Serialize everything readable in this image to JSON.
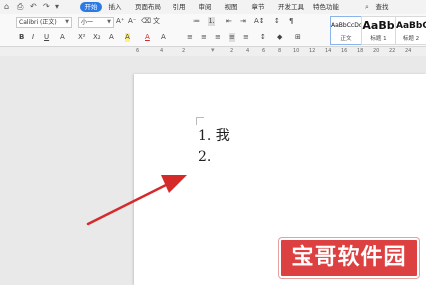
{
  "quick_access": [
    "⌂",
    "⎙",
    "↶",
    "↷",
    "▾"
  ],
  "menu": {
    "items": [
      "开始",
      "插入",
      "页面布局",
      "引用",
      "审阅",
      "视图",
      "章节",
      "开发工具",
      "特色功能"
    ],
    "active_index": 0,
    "search_label": "查找"
  },
  "font": {
    "name": "Calibri (正文)",
    "size": "小一"
  },
  "format_buttons": {
    "bold": "B",
    "italic": "I",
    "underline": "U",
    "strike": "A",
    "superscript": "X²",
    "subscript": "X₂",
    "highlight": "A",
    "font_color": "A",
    "clear": "A"
  },
  "paragraph_buttons": [
    "≔",
    "⒈",
    "⇤",
    "⇥",
    "A↕",
    "↕"
  ],
  "styles": [
    {
      "sample": "AaBbCcDd",
      "name": "正文"
    },
    {
      "sample": "AaBb",
      "name": "标题 1"
    },
    {
      "sample": "AaBbC",
      "name": "标题 2"
    }
  ],
  "ruler": [
    "6",
    "4",
    "2",
    "2",
    "4",
    "6",
    "8",
    "10",
    "12",
    "14",
    "16",
    "18",
    "20",
    "22",
    "24"
  ],
  "document": {
    "lines": [
      "1. 我",
      "2."
    ]
  },
  "watermark": "宝哥软件园",
  "colors": {
    "accent": "#2b79e3",
    "arrow": "#d42a2a",
    "watermark": "#dd4040"
  }
}
